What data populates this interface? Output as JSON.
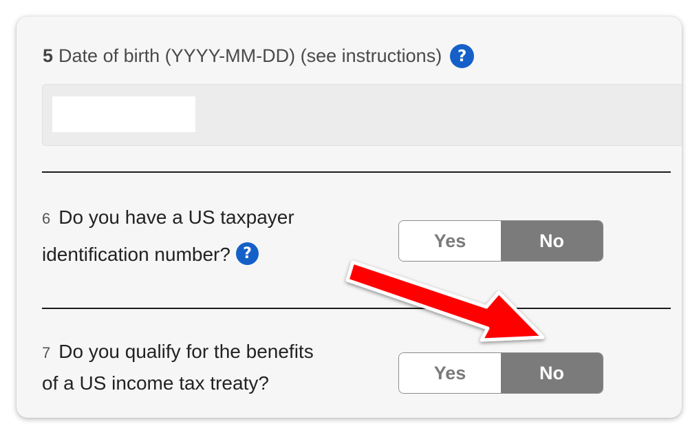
{
  "q5": {
    "number": "5",
    "label": "Date of birth (YYYY-MM-DD) (see instructions)",
    "help": "?",
    "value": ""
  },
  "q6": {
    "number": "6",
    "line1": "Do you have a US taxpayer",
    "line2": "identification number?",
    "help": "?",
    "yes_label": "Yes",
    "no_label": "No",
    "selected": "No"
  },
  "q7": {
    "number": "7",
    "line1": "Do you qualify for the benefits",
    "line2": "of a US income tax treaty?",
    "yes_label": "Yes",
    "no_label": "No",
    "selected": "No"
  },
  "colors": {
    "help_icon": "#1460c8",
    "selected_toggle": "#7b7b7b",
    "arrow": "#ff0000"
  },
  "icons": {
    "help": "question-mark-circle-icon",
    "annotation": "red-arrow-icon"
  }
}
